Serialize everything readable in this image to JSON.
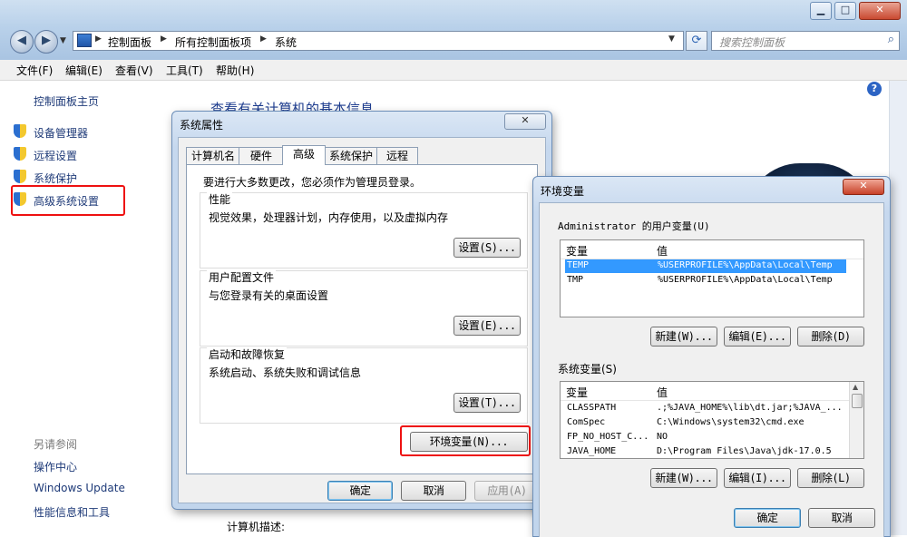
{
  "window": {
    "buttons": {
      "minimize": "▁",
      "maximize": "□",
      "close": "✕"
    }
  },
  "address": {
    "crumbs": [
      "控制面板",
      "所有控制面板项",
      "系统"
    ],
    "search_placeholder": "搜索控制面板"
  },
  "menu": [
    "文件(F)",
    "编辑(E)",
    "查看(V)",
    "工具(T)",
    "帮助(H)"
  ],
  "leftpane": {
    "home": "控制面板主页",
    "links": [
      "设备管理器",
      "远程设置",
      "系统保护",
      "高级系统设置"
    ],
    "see_also_title": "另请参阅",
    "see_also": [
      "操作中心",
      "Windows Update",
      "性能信息和工具"
    ]
  },
  "main": {
    "heading": "查看有关计算机的基本信息",
    "computer_desc_label": "计算机描述:"
  },
  "sysprops": {
    "title": "系统属性",
    "tabs": [
      "计算机名",
      "硬件",
      "高级",
      "系统保护",
      "远程"
    ],
    "admin_note": "要进行大多数更改，您必须作为管理员登录。",
    "perf_title": "性能",
    "perf_desc": "视觉效果，处理器计划，内存使用，以及虚拟内存",
    "profile_title": "用户配置文件",
    "profile_desc": "与您登录有关的桌面设置",
    "startup_title": "启动和故障恢复",
    "startup_desc": "系统启动、系统失败和调试信息",
    "settings_s": "设置(S)...",
    "settings_e": "设置(E)...",
    "settings_t": "设置(T)...",
    "env_button": "环境变量(N)...",
    "ok": "确定",
    "cancel": "取消",
    "apply": "应用(A)"
  },
  "envvars": {
    "title": "环境变量",
    "user_section": "Administrator 的用户变量(U)",
    "col_var": "变量",
    "col_val": "值",
    "user_vars": [
      {
        "name": "TEMP",
        "value": "%USERPROFILE%\\AppData\\Local\\Temp"
      },
      {
        "name": "TMP",
        "value": "%USERPROFILE%\\AppData\\Local\\Temp"
      }
    ],
    "sys_section": "系统变量(S)",
    "sys_vars": [
      {
        "name": "CLASSPATH",
        "value": ".;%JAVA_HOME%\\lib\\dt.jar;%JAVA_..."
      },
      {
        "name": "ComSpec",
        "value": "C:\\Windows\\system32\\cmd.exe"
      },
      {
        "name": "FP_NO_HOST_C...",
        "value": "NO"
      },
      {
        "name": "JAVA_HOME",
        "value": "D:\\Program Files\\Java\\jdk-17.0.5"
      }
    ],
    "new_w": "新建(W)...",
    "edit_e": "编辑(E)...",
    "delete_d": "删除(D)",
    "new_w2": "新建(W)...",
    "edit_i": "编辑(I)...",
    "delete_l": "删除(L)",
    "ok": "确定",
    "cancel": "取消"
  }
}
